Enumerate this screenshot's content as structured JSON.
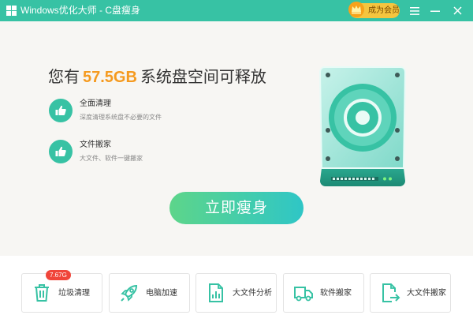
{
  "window": {
    "title": "Windows优化大师 - C盘瘦身",
    "vip_label": "成为会员"
  },
  "main": {
    "headline_prefix": "您有",
    "headline_size": "57.5GB",
    "headline_suffix": "系统盘空间可释放",
    "features": [
      {
        "title": "全面清理",
        "desc": "深度清理系统盘不必要的文件",
        "icon": "thumbs-up-icon"
      },
      {
        "title": "文件搬家",
        "desc": "大文件、软件一键搬家",
        "icon": "thumbs-up-icon"
      }
    ],
    "action_button": "立即瘦身"
  },
  "tools": [
    {
      "label": "垃圾清理",
      "icon": "trash-icon",
      "badge": "7.67G"
    },
    {
      "label": "电脑加速",
      "icon": "rocket-icon"
    },
    {
      "label": "大文件分析",
      "icon": "file-chart-icon"
    },
    {
      "label": "软件搬家",
      "icon": "truck-icon"
    },
    {
      "label": "大文件搬家",
      "icon": "file-move-icon"
    }
  ],
  "colors": {
    "accent": "#37c2a4",
    "highlight": "#f59a1f",
    "badge": "#f0453a",
    "vip": "#f5c53f"
  }
}
